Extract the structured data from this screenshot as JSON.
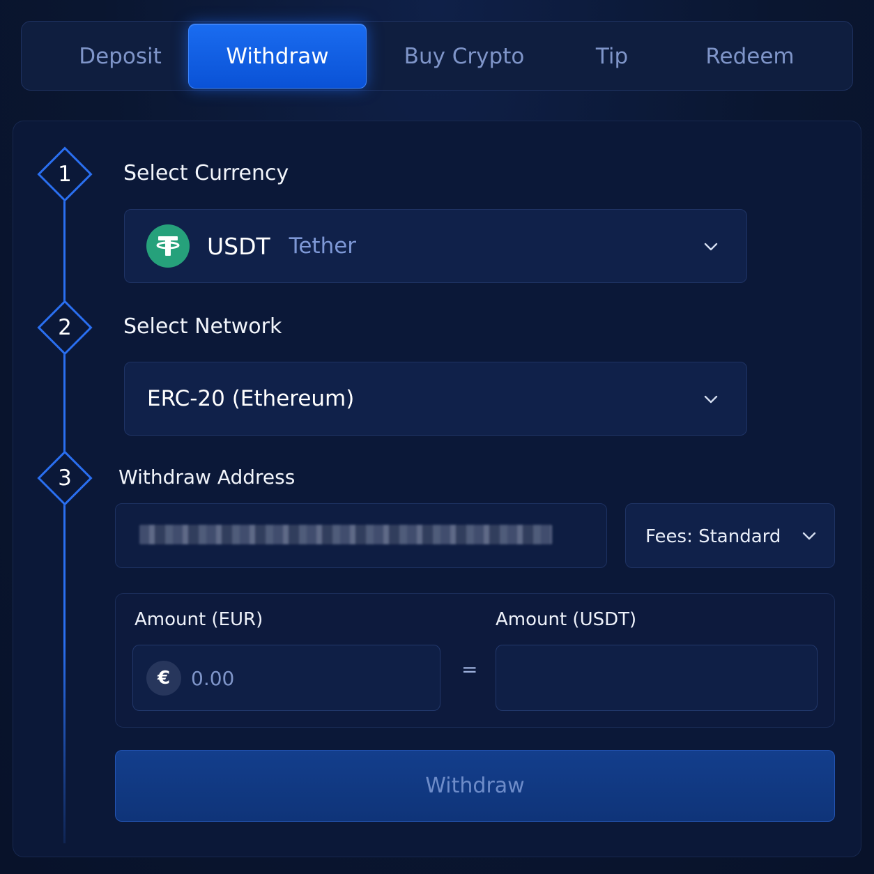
{
  "tabs": [
    {
      "label": "Deposit",
      "active": false
    },
    {
      "label": "Withdraw",
      "active": true
    },
    {
      "label": "Buy Crypto",
      "active": false
    },
    {
      "label": "Tip",
      "active": false
    },
    {
      "label": "Redeem",
      "active": false
    }
  ],
  "steps": {
    "step1": {
      "number": "1",
      "title": "Select Currency"
    },
    "step2": {
      "number": "2",
      "title": "Select Network"
    },
    "step3": {
      "number": "3",
      "title": "Withdraw Address"
    }
  },
  "currency": {
    "code": "USDT",
    "name": "Tether",
    "icon": "tether-icon",
    "icon_color": "#26a17b"
  },
  "network": {
    "selected": "ERC-20 (Ethereum)"
  },
  "address": {
    "value_redacted": true
  },
  "fees": {
    "selected": "Fees: Standard"
  },
  "amount": {
    "eur_label": "Amount (EUR)",
    "eur_symbol": "€",
    "eur_placeholder": "0.00",
    "equals": "=",
    "usdt_label": "Amount (USDT)",
    "usdt_value": ""
  },
  "submit": {
    "label": "Withdraw"
  },
  "colors": {
    "accent": "#1a6cf0",
    "background": "#0a1630",
    "tether_green": "#26a17b"
  }
}
